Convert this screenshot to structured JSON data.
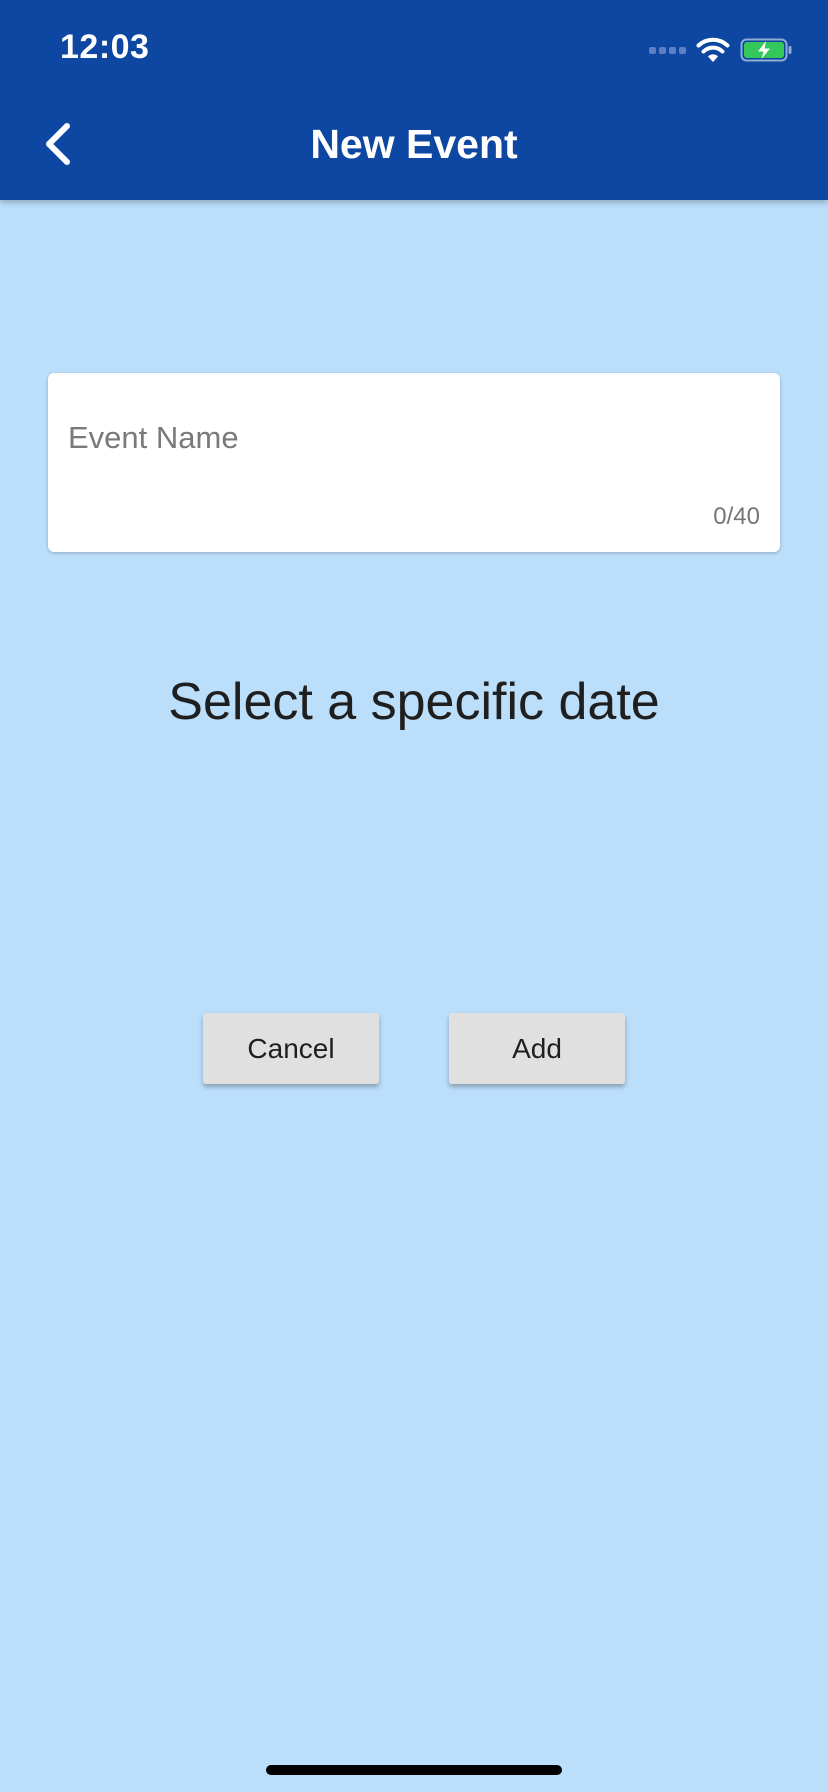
{
  "status_bar": {
    "time": "12:03",
    "signal_icon": "signal-dots-icon",
    "wifi_icon": "wifi-icon",
    "battery_icon": "battery-charging-icon",
    "battery_color": "#34c759"
  },
  "app_bar": {
    "title": "New Event",
    "back_icon": "chevron-left-icon",
    "background_color": "#0d47a1"
  },
  "form": {
    "event_name": {
      "placeholder": "Event Name",
      "value": "",
      "counter": "0/40"
    },
    "date_prompt": "Select a specific date"
  },
  "actions": {
    "cancel_label": "Cancel",
    "add_label": "Add"
  },
  "colors": {
    "page_background": "#bbdefa",
    "button_background": "#e0e0e0"
  }
}
